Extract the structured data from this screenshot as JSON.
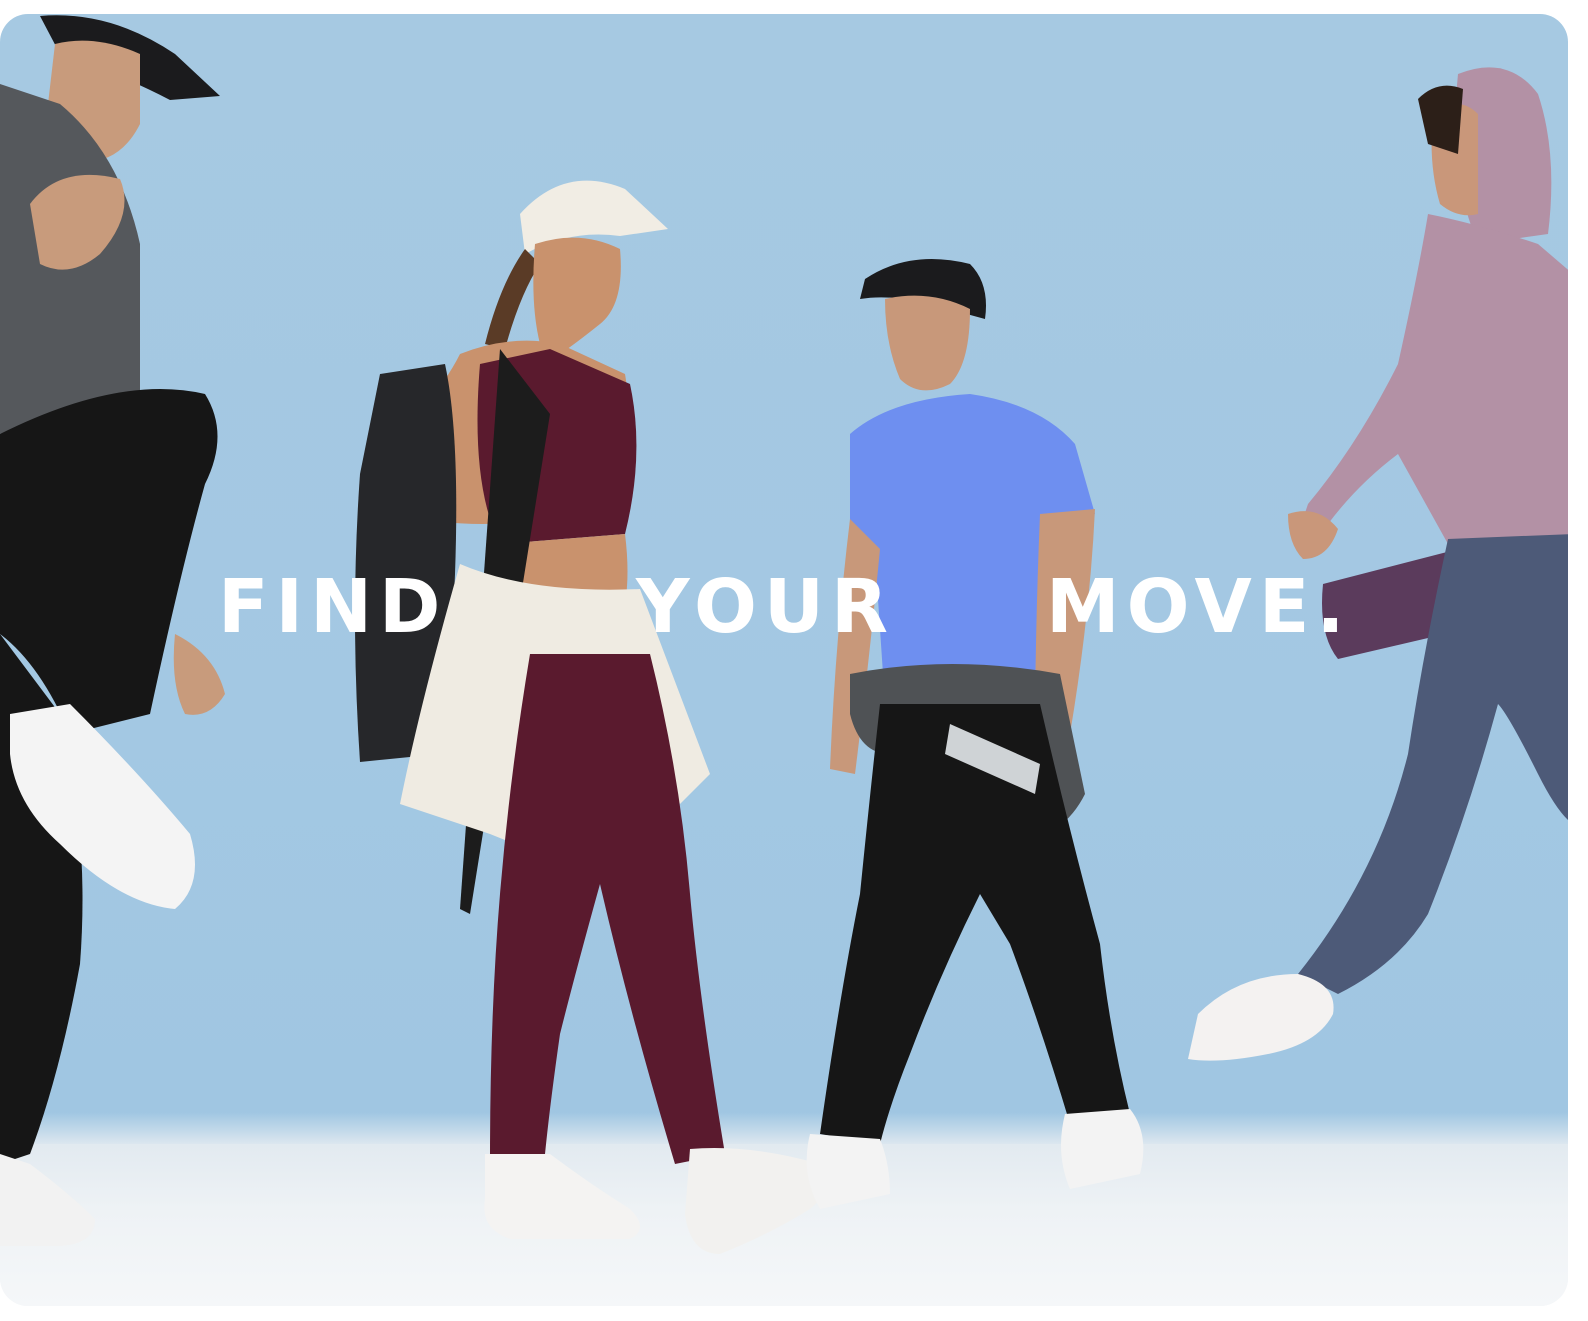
{
  "hero": {
    "headline_words": [
      "FIND",
      "YOUR",
      "MOVE."
    ]
  },
  "colors": {
    "backdrop": "#a6c9e2",
    "headline": "#ffffff",
    "burgundy": "#5a1a2e",
    "royal_blue": "#6e8ff0",
    "mauve": "#b391a5",
    "slate_blue": "#4d5a78",
    "charcoal": "#55585c",
    "black": "#161616"
  }
}
